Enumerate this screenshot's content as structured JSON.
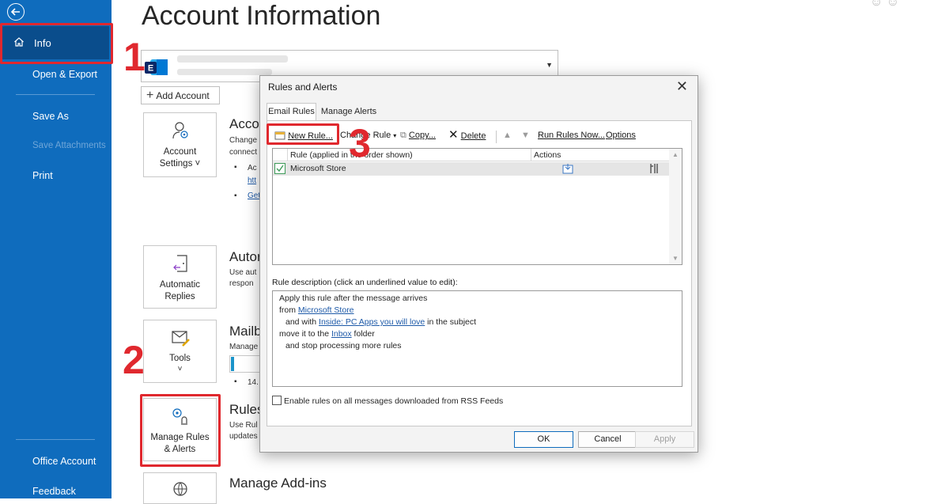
{
  "sidebar": {
    "info_label": "Info",
    "open_export": "Open & Export",
    "save_as": "Save As",
    "save_attachments": "Save Attachments",
    "print": "Print",
    "office_account": "Office Account",
    "feedback": "Feedback"
  },
  "main": {
    "title": "Account Information",
    "add_account": "Add Account",
    "account_settings": {
      "tile_line1": "Account",
      "tile_line2": "Settings ˅",
      "section_title": "Acco",
      "text1": "Change",
      "text2": "connect",
      "bullet1": "Ac",
      "link1": "htt",
      "link2": "Get"
    },
    "automatic_replies": {
      "tile_line1": "Automatic",
      "tile_line2": "Replies",
      "section_title": "Autor",
      "text1": "Use aut",
      "text2": "respon"
    },
    "tools": {
      "tile_line1": "Tools",
      "tile_line2": "˅",
      "section_title": "Mailb",
      "text1": "Manage",
      "bullet1": "14."
    },
    "manage_rules": {
      "tile_line1": "Manage Rules",
      "tile_line2": "& Alerts",
      "section_title": "Rules",
      "text1": "Use Rul",
      "text2": "updates"
    },
    "manage_addins": {
      "section_title": "Manage Add-ins"
    }
  },
  "annotations": {
    "step1": "1",
    "step2": "2",
    "step3": "3"
  },
  "dialog": {
    "title": "Rules and Alerts",
    "close": "✕",
    "tabs": [
      "Email Rules",
      "Manage Alerts"
    ],
    "toolbar": {
      "new_rule": "New Rule...",
      "change_rule": "Change Rule",
      "copy": "Copy...",
      "delete": "Delete",
      "run_rules_now": "Run Rules Now...",
      "options": "Options"
    },
    "columns": {
      "rule": "Rule (applied in the order shown)",
      "actions": "Actions"
    },
    "rules": [
      {
        "name": "Microsoft Store",
        "enabled": true
      }
    ],
    "description_label": "Rule description (click an underlined value to edit):",
    "description": {
      "line1": "Apply this rule after the message arrives",
      "line2_pre": "from ",
      "line2_link": "Microsoft Store",
      "line3_pre": "and with ",
      "line3_link": "Inside: PC Apps you will love",
      "line3_post": " in the subject",
      "line4_pre": "move it to the ",
      "line4_link": "Inbox",
      "line4_post": " folder",
      "line5": "and stop processing more rules"
    },
    "rss_label": "Enable rules on all messages downloaded from RSS Feeds",
    "buttons": {
      "ok": "OK",
      "cancel": "Cancel",
      "apply": "Apply"
    }
  },
  "colors": {
    "sidebar_bg": "#0f6cbd",
    "sidebar_selected": "#0a4d8c",
    "annotation_red": "#e0282e",
    "link_blue": "#1e5aa8"
  }
}
